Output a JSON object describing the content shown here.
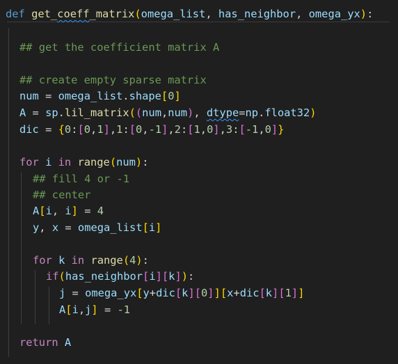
{
  "code": {
    "def_kw": "def",
    "func_name_a": "get_",
    "func_name_b": "coeff",
    "func_name_c": "_matrix",
    "param_omega_list": "omega_list",
    "param_has_neighbor": "has_neighbor",
    "param_omega_yx": "omega_yx",
    "comment_get_coeff": "## get the coefficient matrix A",
    "comment_create_sparse": "## create empty sparse matrix",
    "var_num": "num",
    "var_omega_list": "omega_list",
    "attr_shape": "shape",
    "num_0": "0",
    "var_A": "A",
    "var_sp": "sp",
    "fn_lil_matrix": "lil_matrix",
    "kw_dtype": "dtype",
    "var_np": "np",
    "attr_float32": "float32",
    "var_dic": "dic",
    "dic_k0": "0",
    "dic_k1": "1",
    "dic_k2": "2",
    "dic_k3": "3",
    "dic_v0a": "0",
    "dic_v0b": "1",
    "dic_v1a": "0",
    "dic_v1b": "-1",
    "dic_v2a": "1",
    "dic_v2b": "0",
    "dic_v3a": "-1",
    "dic_v3b": "0",
    "for_kw": "for",
    "in_kw": "in",
    "fn_range": "range",
    "var_i": "i",
    "comment_fill": "## fill 4 or -1",
    "comment_center": "## center",
    "num_4": "4",
    "var_y": "y",
    "var_x": "x",
    "var_k": "k",
    "if_kw": "if",
    "var_has_neighbor": "has_neighbor",
    "var_j": "j",
    "var_omega_yx": "omega_yx",
    "num_1": "1",
    "num_neg1": "-1",
    "return_kw": "return"
  }
}
